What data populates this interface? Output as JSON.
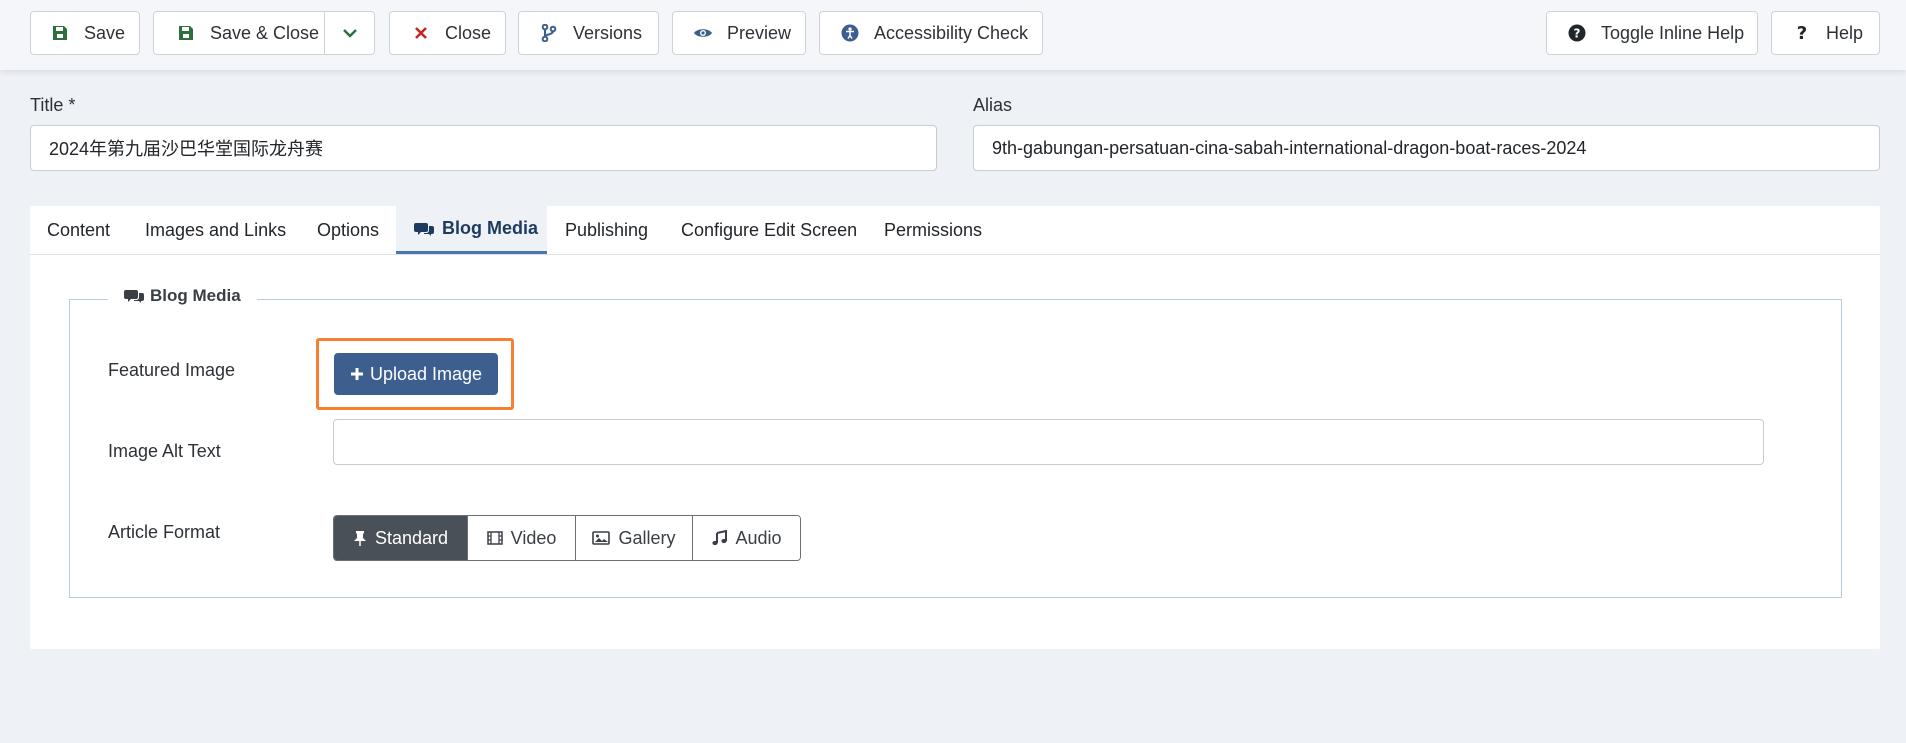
{
  "toolbar": {
    "save": "Save",
    "save_close": "Save & Close",
    "close": "Close",
    "versions": "Versions",
    "preview": "Preview",
    "accessibility": "Accessibility Check",
    "toggle_help": "Toggle Inline Help",
    "help": "Help"
  },
  "form": {
    "title_label": "Title *",
    "title_value": "2024年第九届沙巴华堂国际龙舟赛",
    "alias_label": "Alias",
    "alias_value": "9th-gabungan-persatuan-cina-sabah-international-dragon-boat-races-2024"
  },
  "tabs": [
    {
      "label": "Content"
    },
    {
      "label": "Images and Links"
    },
    {
      "label": "Options"
    },
    {
      "label": "Blog Media"
    },
    {
      "label": "Publishing"
    },
    {
      "label": "Configure Edit Screen"
    },
    {
      "label": "Permissions"
    }
  ],
  "blog_media": {
    "legend": "Blog Media",
    "featured_image_label": "Featured Image",
    "upload_label": "Upload Image",
    "alt_text_label": "Image Alt Text",
    "alt_text_value": "",
    "format_label": "Article Format",
    "formats": [
      {
        "label": "Standard",
        "icon": "pin-icon",
        "active": true
      },
      {
        "label": "Video",
        "icon": "film-icon",
        "active": false
      },
      {
        "label": "Gallery",
        "icon": "image-icon",
        "active": false
      },
      {
        "label": "Audio",
        "icon": "music-icon",
        "active": false
      }
    ]
  },
  "colors": {
    "save_green": "#2f6f3e",
    "close_red": "#c52827",
    "accent_blue": "#3d5f8f",
    "highlight_orange": "#f58032",
    "active_segment": "#4a5058"
  }
}
